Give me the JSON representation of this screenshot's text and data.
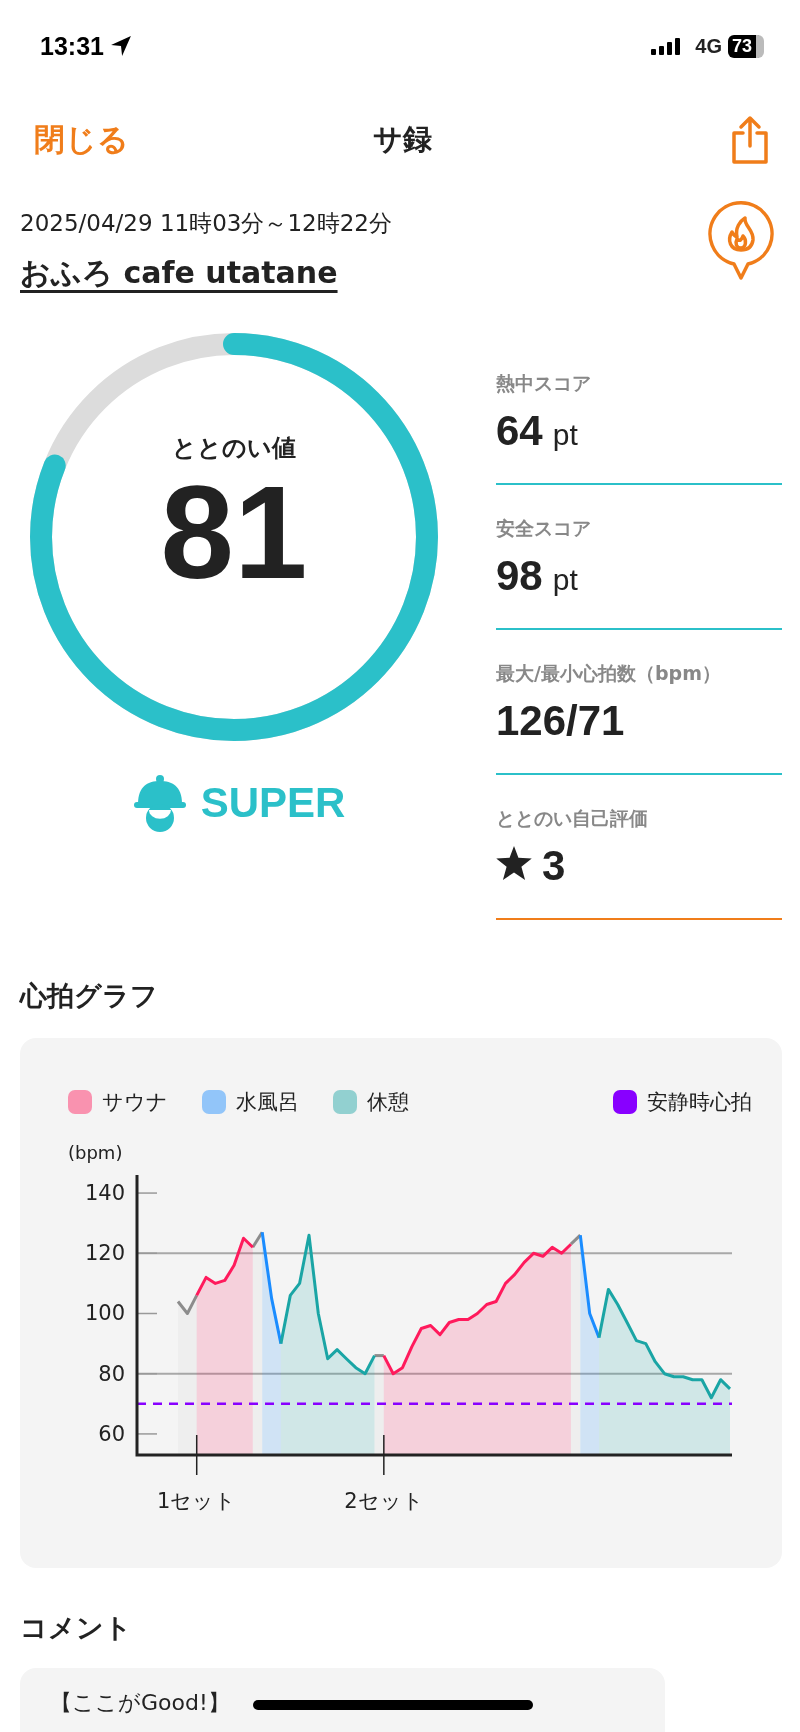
{
  "status_bar": {
    "time": "13:31",
    "network": "4G",
    "battery": "73"
  },
  "nav": {
    "close": "閉じる",
    "title": "サ録"
  },
  "session": {
    "datetime": "2025/04/29 11時03分～12時22分",
    "venue": "おふろ cafe utatane"
  },
  "score": {
    "label": "ととのい値",
    "value": "81",
    "rank": "SUPER"
  },
  "stats": [
    {
      "kind": "value",
      "label": "熱中スコア",
      "value": "64",
      "unit": "pt",
      "color": "#2bc0c9"
    },
    {
      "kind": "value",
      "label": "安全スコア",
      "value": "98",
      "unit": "pt",
      "color": "#2bc0c9"
    },
    {
      "kind": "value",
      "label": "最大/最小心拍数（bpm）",
      "value": "126/71",
      "color": "#2bc0c9"
    },
    {
      "kind": "rating",
      "label": "ととのい自己評価",
      "value": "3",
      "color": "#f07d1a"
    }
  ],
  "heart_graph": {
    "title": "心拍グラフ",
    "chart_data": {
      "type": "area",
      "ylabel": "(bpm)",
      "ylim": [
        53,
        146
      ],
      "yticks": [
        60,
        80,
        100,
        120,
        140
      ],
      "categories": [
        null,
        null,
        "1セット",
        null,
        null,
        null,
        null,
        null,
        null,
        null,
        null,
        null,
        null,
        null,
        null,
        null,
        null,
        null,
        null,
        null,
        null,
        null,
        "2セット",
        null,
        null,
        null,
        null,
        null,
        null,
        null,
        null,
        null,
        null,
        null,
        null,
        null,
        null,
        null,
        null,
        null,
        null,
        null,
        null,
        null,
        null,
        null,
        null,
        null,
        null,
        null,
        null,
        null,
        null,
        null,
        null,
        null,
        null,
        null,
        null,
        null
      ],
      "series": [
        {
          "color": "#8c8c8c",
          "values": [
            104,
            100,
            106,
            null,
            null,
            null,
            null,
            null,
            122,
            127,
            null,
            null,
            null,
            null,
            null,
            null,
            null,
            null,
            null,
            null,
            null,
            86,
            86,
            null,
            null,
            null,
            null,
            null,
            null,
            null,
            null,
            null,
            null,
            null,
            null,
            null,
            null,
            null,
            null,
            null,
            null,
            null,
            123,
            126,
            null,
            null,
            null,
            null,
            null,
            null,
            null,
            null,
            null,
            null,
            null,
            null,
            null,
            null,
            null,
            null
          ]
        },
        {
          "name": "サウナ",
          "color": "#ff1a5c",
          "values": [
            null,
            null,
            106,
            112,
            110,
            111,
            116,
            125,
            122,
            null,
            null,
            null,
            null,
            null,
            null,
            null,
            null,
            null,
            null,
            null,
            null,
            null,
            86,
            80,
            82,
            89,
            95,
            96,
            93,
            97,
            98,
            98,
            100,
            103,
            104,
            110,
            113,
            117,
            120,
            119,
            122,
            120,
            123,
            null,
            null,
            null,
            null,
            null,
            null,
            null,
            null,
            null,
            null,
            null,
            null,
            null,
            null,
            null,
            null,
            null
          ]
        },
        {
          "name": "水風呂",
          "color": "#1a8cff",
          "values": [
            null,
            null,
            null,
            null,
            null,
            null,
            null,
            null,
            null,
            127,
            105,
            90,
            null,
            null,
            null,
            null,
            null,
            null,
            null,
            null,
            null,
            null,
            null,
            null,
            null,
            null,
            null,
            null,
            null,
            null,
            null,
            null,
            null,
            null,
            null,
            null,
            null,
            null,
            null,
            null,
            null,
            null,
            null,
            126,
            100,
            92,
            null,
            null,
            null,
            null,
            null,
            null,
            null,
            null,
            null,
            null,
            null,
            null,
            null,
            null
          ]
        },
        {
          "name": "休憩",
          "color": "#1aa5a5",
          "values": [
            null,
            null,
            null,
            null,
            null,
            null,
            null,
            null,
            null,
            null,
            null,
            90,
            106,
            110,
            126,
            100,
            85,
            88,
            85,
            82,
            80,
            86,
            null,
            null,
            null,
            null,
            null,
            null,
            null,
            null,
            null,
            null,
            null,
            null,
            null,
            null,
            null,
            null,
            null,
            null,
            null,
            null,
            null,
            null,
            null,
            92,
            108,
            103,
            97,
            91,
            90,
            84,
            80,
            79,
            79,
            78,
            78,
            72,
            78,
            75
          ]
        }
      ],
      "ref_lines": [
        {
          "axis": "y",
          "value": 70,
          "label": "安静時心拍",
          "color": "#8800ff"
        }
      ]
    }
  },
  "comments": {
    "title": "コメント",
    "items": [
      "【ここがGood!】"
    ]
  }
}
